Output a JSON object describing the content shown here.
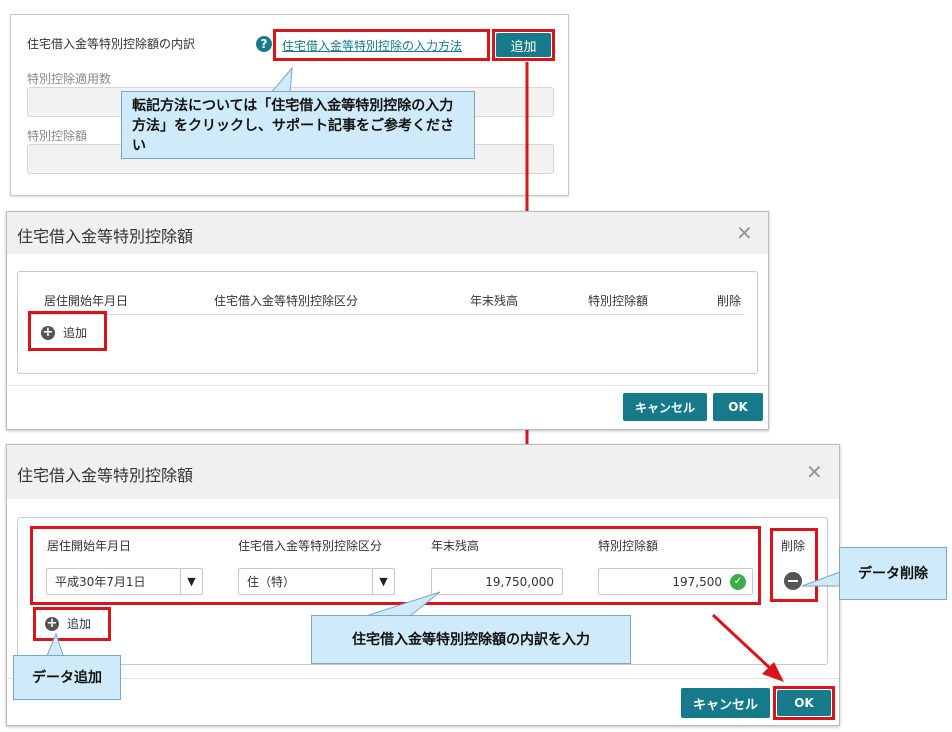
{
  "top_panel": {
    "section_title": "住宅借入金等特別控除額の内訳",
    "help_icon": "question-circle-icon",
    "help_link": "住宅借入金等特別控除の入力方法",
    "add_button": "追加",
    "field1_label": "特別控除適用数",
    "field2_label": "特別控除額",
    "callout": "転記方法については「住宅借入金等特別控除の入力方法」をクリックし、サポート記事をご参考ください"
  },
  "dialog1": {
    "title": "住宅借入金等特別控除額",
    "close_icon": "close-icon",
    "columns": [
      "居住開始年月日",
      "住宅借入金等特別控除区分",
      "年末残高",
      "特別控除額",
      "削除"
    ],
    "add_label": "追加",
    "cancel_button": "キャンセル",
    "ok_button": "OK"
  },
  "dialog2": {
    "title": "住宅借入金等特別控除額",
    "close_icon": "close-icon",
    "columns": [
      "居住開始年月日",
      "住宅借入金等特別控除区分",
      "年末残高",
      "特別控除額"
    ],
    "delete_header": "削除",
    "row": {
      "start_date": "平成30年7月1日",
      "category": "住（特）",
      "balance": "19,750,000",
      "deduction": "197,500"
    },
    "add_label": "追加",
    "cancel_button": "キャンセル",
    "ok_button": "OK"
  },
  "callouts": {
    "delete": "データ削除",
    "add": "データ追加",
    "input": "住宅借入金等特別控除額の内訳を入力"
  },
  "colors": {
    "accent": "#167a8a",
    "highlight": "#d9151b",
    "callout_bg": "#cfeaf8"
  }
}
